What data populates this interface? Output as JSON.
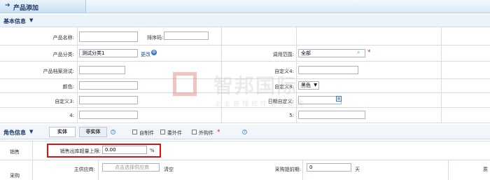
{
  "title": {
    "label": "产品添加"
  },
  "basic": {
    "header": "基本信息",
    "name_label": "产品名称:",
    "sort_label": "排序码:",
    "category_label": "产品分类:",
    "category_value": "测试分类1",
    "change_link": "更改",
    "scope_label": "调用范围:",
    "scope_value": "全部",
    "profile_label": "产品档案测试:",
    "custom4_label": "自定义4:",
    "color_label": "颜色:",
    "custom8_label": "自定义8:",
    "custom8_value": "黑色",
    "custom3_label": "自定义3:",
    "date_custom_label": "日期自定义:",
    "field4_label": "4:",
    "field5_label": "5:"
  },
  "role": {
    "header": "角色信息",
    "tab_entity": "实体",
    "tab_nonentity": "非实体",
    "chk_self": "自制件",
    "chk_outsource": "委外件",
    "chk_purchase": "外购件"
  },
  "sales": {
    "section_label": "销售",
    "limit_label": "销售出库超量上限:",
    "limit_value": "0.00",
    "limit_unit": "%"
  },
  "purchase": {
    "section_label": "采购",
    "supplier_label": "主供应商:",
    "supplier_placeholder": "点击选择供应商",
    "clear_link": "清空",
    "lead_label": "采购提前期:",
    "lead_value": "0",
    "lead_unit": "天",
    "trailing_text": "质"
  },
  "watermark": {
    "brand": "智邦国际",
    "slogan": "企业管理软件服务品牌"
  },
  "colors": {
    "required": "#e02020",
    "highlight": "#e01010",
    "header_text": "#1b3a66"
  }
}
